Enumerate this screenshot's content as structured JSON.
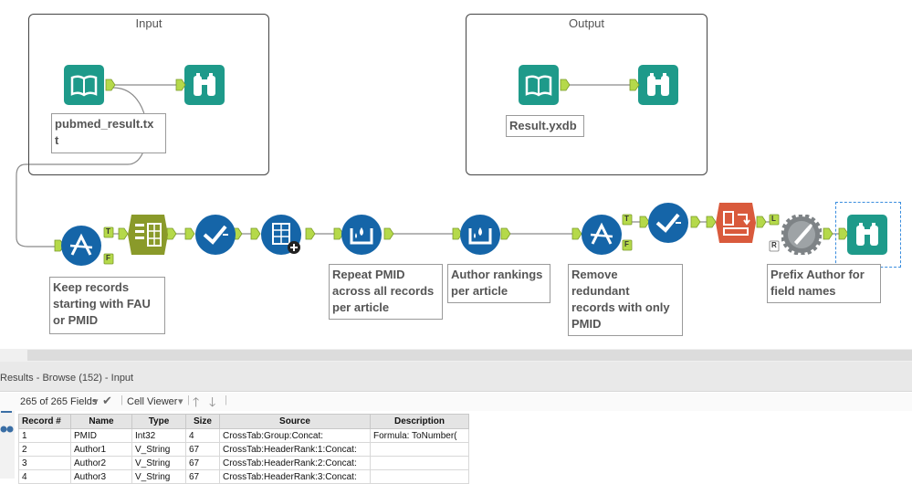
{
  "containers": {
    "input_title": "Input",
    "output_title": "Output"
  },
  "annotations": {
    "input_file": "pubmed_result.tx\nt",
    "output_file": "Result.yxdb",
    "filter1": "Keep records\nstarting with FAU\nor PMID",
    "multirow1": "Repeat PMID\nacross all records\nper article",
    "multirow2": "Author rankings\nper article",
    "filter2": "Remove\nredundant\nrecords with only\nPMID",
    "formula": "Prefix Author for\nfield names"
  },
  "anchors": {
    "true": "T",
    "false": "F",
    "left": "L",
    "right": "R"
  },
  "colors": {
    "teal": "#1e9a8a",
    "blue": "#1565a8",
    "olive": "#8a9a2a",
    "orange": "#d95a3c",
    "gray": "#7e8386",
    "anchor_green": "#b5d94a"
  },
  "results": {
    "title": "Results - Browse (152) - Input",
    "fields_select": "265 of 265 Fields",
    "viewer_select": "Cell Viewer",
    "columns": [
      "Record #",
      "Name",
      "Type",
      "Size",
      "Source",
      "Description"
    ],
    "rows": [
      [
        "1",
        "PMID",
        "Int32",
        "4",
        "CrossTab:Group:Concat:",
        "Formula: ToNumber("
      ],
      [
        "2",
        "Author1",
        "V_String",
        "67",
        "CrossTab:HeaderRank:1:Concat:",
        ""
      ],
      [
        "3",
        "Author2",
        "V_String",
        "67",
        "CrossTab:HeaderRank:2:Concat:",
        ""
      ],
      [
        "4",
        "Author3",
        "V_String",
        "67",
        "CrossTab:HeaderRank:3:Concat:",
        ""
      ]
    ]
  }
}
